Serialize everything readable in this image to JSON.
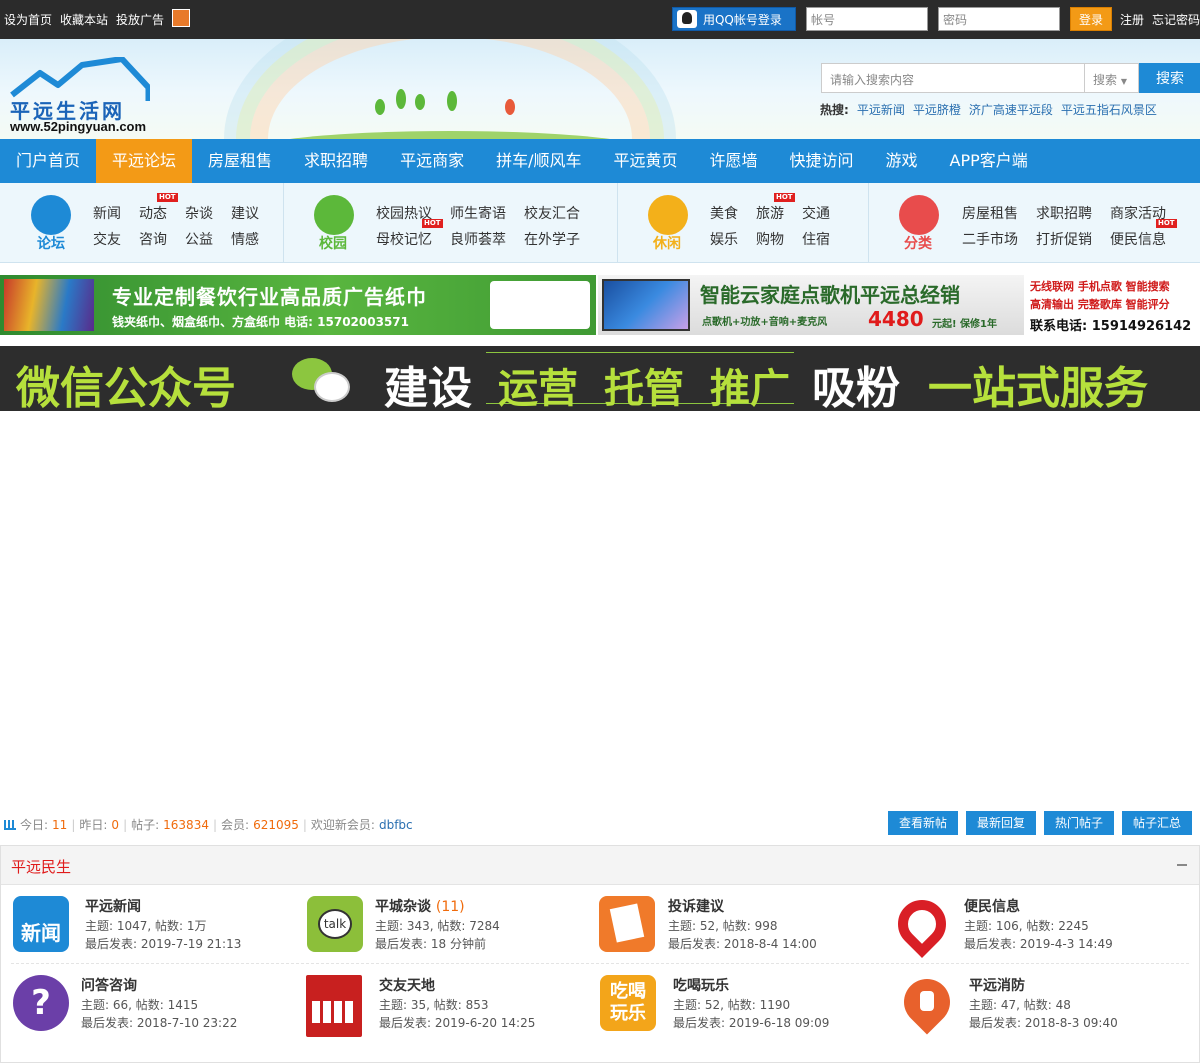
{
  "topbar": {
    "links": [
      "设为首页",
      "收藏本站",
      "投放广告"
    ],
    "qq_login_label": "用QQ帐号登录",
    "username_placeholder": "帐号",
    "password_placeholder": "密码",
    "login_label": "登录",
    "register_label": "注册",
    "forgot_label": "忘记密码"
  },
  "header": {
    "logo_name": "平远生活网",
    "logo_url": "www.52pingyuan.com",
    "search_placeholder": "请输入搜索内容",
    "search_type": "搜索",
    "search_button": "搜索",
    "hot_label": "热搜:",
    "hot_terms": [
      "平远新闻",
      "平远脐橙",
      "济广高速平远段",
      "平远五指石风景区"
    ]
  },
  "nav": {
    "items": [
      "门户首页",
      "平远论坛",
      "房屋租售",
      "求职招聘",
      "平远商家",
      "拼车/顺风车",
      "平远黄页",
      "许愿墙",
      "快捷访问",
      "游戏",
      "APP客户端"
    ],
    "active_index": 1,
    "accent": "#1e8ad6",
    "active_color": "#f39a16"
  },
  "subnav": {
    "groups": [
      {
        "label": "论坛",
        "color": "#1e8ad6",
        "links": [
          "新闻",
          "动态",
          "杂谈",
          "建议",
          "交友",
          "咨询",
          "公益",
          "情感"
        ],
        "hot": [
          1
        ]
      },
      {
        "label": "校园",
        "color": "#5cb83a",
        "links": [
          "校园热议",
          "师生寄语",
          "校友汇合",
          "母校记忆",
          "良师荟萃",
          "在外学子"
        ],
        "hot": [
          3
        ]
      },
      {
        "label": "休闲",
        "color": "#f3b01a",
        "links": [
          "美食",
          "旅游",
          "交通",
          "娱乐",
          "购物",
          "住宿"
        ],
        "hot": [
          1
        ]
      },
      {
        "label": "分类",
        "color": "#e84c4c",
        "links": [
          "房屋租售",
          "求职招聘",
          "商家活动",
          "二手市场",
          "打折促销",
          "便民信息"
        ],
        "hot": [
          5
        ]
      }
    ],
    "hot_badge": "HOT"
  },
  "banners": {
    "b1_title": "专业定制餐饮行业高品质广告纸巾",
    "b1_sub": "钱夹纸巾、烟盒纸巾、方盒纸巾 电话: 15702003571",
    "b2_title": "智能云家庭点歌机平远总经销",
    "b2_sub_left": "点歌机+功放+音响+麦克风",
    "b2_price": "4480",
    "b2_price_unit": "元起! 保修1年",
    "b2_right_lines": [
      "无线联网 手机点歌 智能搜索",
      "高清输出 完整歌库 智能评分"
    ],
    "b2_phone": "联系电话: 15914926142",
    "b3_parts": [
      "微信公众号",
      "建设",
      "运营",
      "托管",
      "推广",
      "吸粉",
      "一站式服务"
    ]
  },
  "stats": {
    "today_label": "今日:",
    "today": "11",
    "yesterday_label": "昨日:",
    "yesterday": "0",
    "posts_label": "帖子:",
    "posts": "163834",
    "members_label": "会员:",
    "members": "621095",
    "welcome_label": "欢迎新会员:",
    "newest_member": "dbfbc",
    "buttons": [
      "查看新帖",
      "最新回复",
      "热门帖子",
      "帖子汇总"
    ]
  },
  "section": {
    "title": "平远民生",
    "forums": [
      {
        "name": "平远新闻",
        "count": "",
        "stat": "主题: 1047, 帖数: 1万",
        "last": "最后发表: 2019-7-19 21:13",
        "icon": "news-icon",
        "icon_text": "新闻",
        "color": "#1e8ad6"
      },
      {
        "name": "平城杂谈",
        "count": "(11)",
        "stat": "主题: 343, 帖数: 7284",
        "last": "最后发表: 18 分钟前",
        "icon": "talk-icon",
        "icon_text": "talk",
        "color": "#8cbf3a"
      },
      {
        "name": "投诉建议",
        "count": "",
        "stat": "主题: 52, 帖数: 998",
        "last": "最后发表: 2018-8-4 14:00",
        "icon": "complaint-icon",
        "icon_text": "",
        "color": "#f07a2a"
      },
      {
        "name": "便民信息",
        "count": "",
        "stat": "主题: 106, 帖数: 2245",
        "last": "最后发表: 2019-4-3 14:49",
        "icon": "info-icon",
        "icon_text": "",
        "color": "#d91f26"
      },
      {
        "name": "问答咨询",
        "count": "",
        "stat": "主题: 66, 帖数: 1415",
        "last": "最后发表: 2018-7-10 23:22",
        "icon": "question-icon",
        "icon_text": "?",
        "color": "#6b3fa8"
      },
      {
        "name": "交友天地",
        "count": "",
        "stat": "主题: 35, 帖数: 853",
        "last": "最后发表: 2019-6-20 14:25",
        "icon": "friends-icon",
        "icon_text": "",
        "color": "#c8201f"
      },
      {
        "name": "吃喝玩乐",
        "count": "",
        "stat": "主题: 52, 帖数: 1190",
        "last": "最后发表: 2019-6-18 09:09",
        "icon": "food-fun-icon",
        "icon_text": "吃喝玩乐",
        "color": "#f3a51a"
      },
      {
        "name": "平远消防",
        "count": "",
        "stat": "主题: 47, 帖数: 48",
        "last": "最后发表: 2018-8-3 09:40",
        "icon": "fire-icon",
        "icon_text": "",
        "color": "#e8612c"
      }
    ]
  }
}
